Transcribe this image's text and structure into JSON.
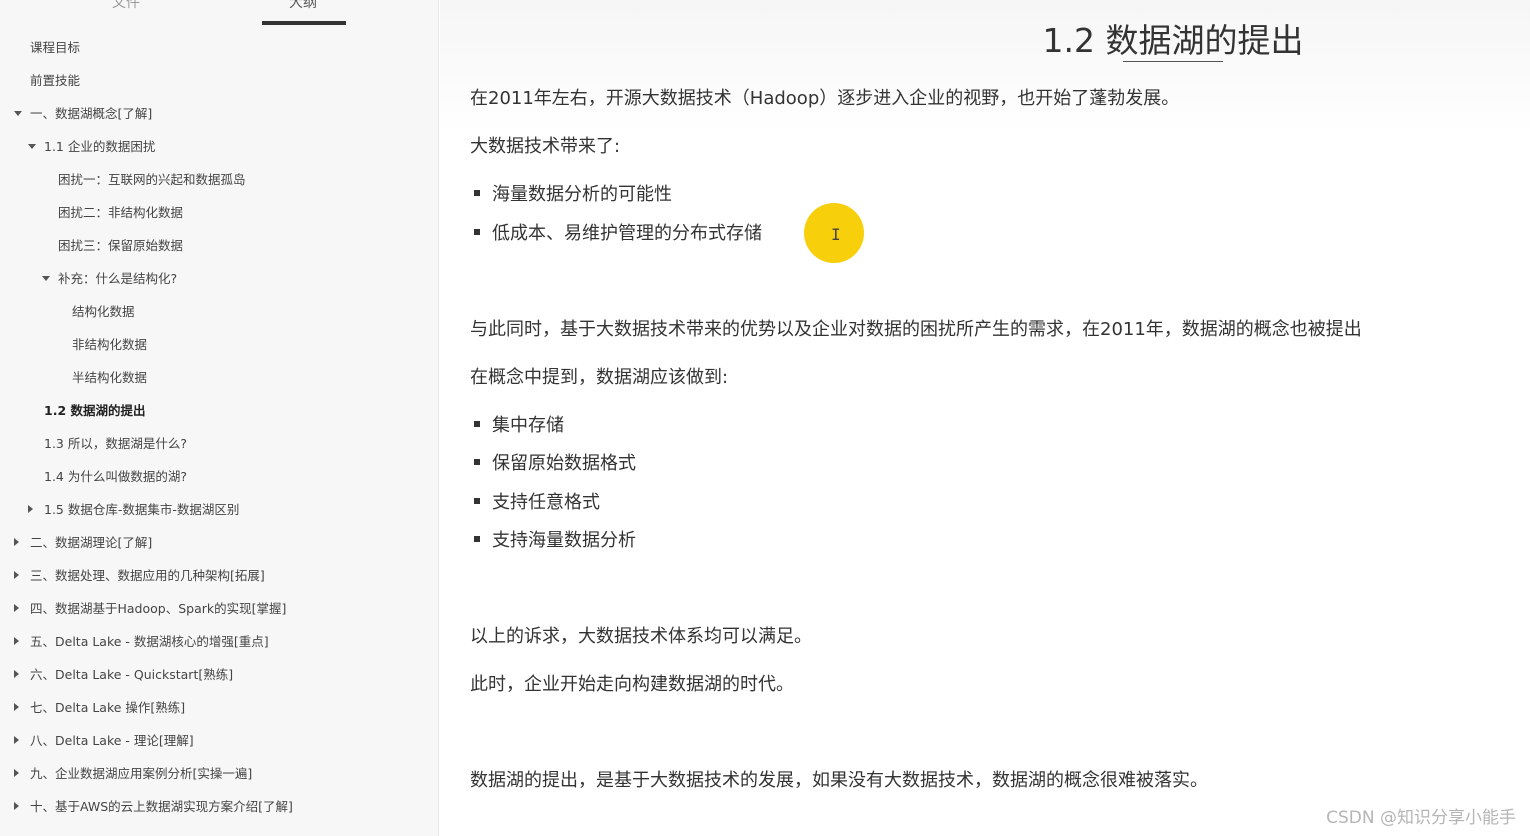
{
  "sidebar": {
    "tabs": {
      "files": "文件",
      "outline": "大纲"
    },
    "items": [
      {
        "label": "课程目标",
        "caret": ""
      },
      {
        "label": "前置技能",
        "caret": ""
      },
      {
        "label": "一、数据湖概念[了解]",
        "caret": "down"
      },
      {
        "label": "1.1 企业的数据困扰",
        "caret": "down"
      },
      {
        "label": "困扰一：互联网的兴起和数据孤岛",
        "caret": ""
      },
      {
        "label": "困扰二：非结构化数据",
        "caret": ""
      },
      {
        "label": "困扰三：保留原始数据",
        "caret": ""
      },
      {
        "label": "补充：什么是结构化?",
        "caret": "down"
      },
      {
        "label": "结构化数据",
        "caret": ""
      },
      {
        "label": "非结构化数据",
        "caret": ""
      },
      {
        "label": "半结构化数据",
        "caret": ""
      },
      {
        "label": "1.2 数据湖的提出",
        "caret": "",
        "active": true
      },
      {
        "label": "1.3 所以，数据湖是什么?",
        "caret": ""
      },
      {
        "label": "1.4 为什么叫做数据的湖?",
        "caret": ""
      },
      {
        "label": "1.5 数据仓库-数据集市-数据湖区别",
        "caret": "right"
      },
      {
        "label": "二、数据湖理论[了解]",
        "caret": "right"
      },
      {
        "label": "三、数据处理、数据应用的几种架构[拓展]",
        "caret": "right"
      },
      {
        "label": "四、数据湖基于Hadoop、Spark的实现[掌握]",
        "caret": "right"
      },
      {
        "label": "五、Delta Lake - 数据湖核心的增强[重点]",
        "caret": "right"
      },
      {
        "label": "六、Delta Lake - Quickstart[熟练]",
        "caret": "right"
      },
      {
        "label": "七、Delta Lake 操作[熟练]",
        "caret": "right"
      },
      {
        "label": "八、Delta Lake - 理论[理解]",
        "caret": "right"
      },
      {
        "label": "九、企业数据湖应用案例分析[实操一遍]",
        "caret": "right"
      },
      {
        "label": "十、基于AWS的云上数据湖实现方案介绍[了解]",
        "caret": "right"
      }
    ]
  },
  "document": {
    "title": "1.2 数据湖的提出",
    "p1": "在2011年左右，开源大数据技术（Hadoop）逐步进入企业的视野，也开始了蓬勃发展。",
    "p2": "大数据技术带来了:",
    "list1": [
      "海量数据分析的可能性",
      "低成本、易维护管理的分布式存储"
    ],
    "p3": "与此同时，基于大数据技术带来的优势以及企业对数据的困扰所产生的需求，在2011年，数据湖的概念也被提出",
    "p4": "在概念中提到，数据湖应该做到:",
    "list2": [
      "集中存储",
      "保留原始数据格式",
      "支持任意格式",
      "支持海量数据分析"
    ],
    "p5": "以上的诉求，大数据技术体系均可以满足。",
    "p6": "此时，企业开始走向构建数据湖的时代。",
    "p7": "数据湖的提出，是基于大数据技术的发展，如果没有大数据技术，数据湖的概念很难被落实。"
  },
  "cursor_glyph": "I",
  "watermark": "CSDN @知识分享小能手",
  "colors": {
    "highlight": "#f7cf0a",
    "text": "#333333",
    "sidebar_bg": "#f7f7f7"
  }
}
